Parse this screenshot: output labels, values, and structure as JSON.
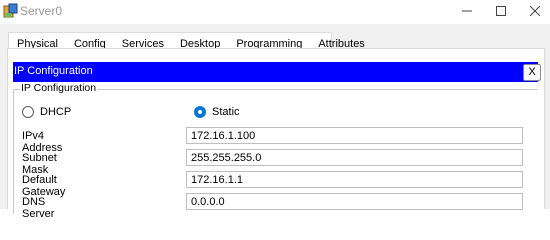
{
  "window": {
    "title": "Server0",
    "icon": "server-app-icon",
    "controls": {
      "minimize": "minimize-icon",
      "maximize": "maximize-icon",
      "close": "close-icon"
    }
  },
  "tabs": [
    {
      "label": "Physical",
      "active": false
    },
    {
      "label": "Config",
      "active": false
    },
    {
      "label": "Services",
      "active": false
    },
    {
      "label": "Desktop",
      "active": true
    },
    {
      "label": "Programming",
      "active": false
    },
    {
      "label": "Attributes",
      "active": false
    }
  ],
  "panel": {
    "header_title": "IP Configuration",
    "close_label": "X",
    "group_title": "IP Configuration",
    "mode": {
      "dhcp_label": "DHCP",
      "static_label": "Static",
      "selected": "Static"
    },
    "fields": [
      {
        "label": "IPv4 Address",
        "value": "172.16.1.100"
      },
      {
        "label": "Subnet Mask",
        "value": "255.255.255.0"
      },
      {
        "label": "Default Gateway",
        "value": "172.16.1.1"
      },
      {
        "label": "DNS Server",
        "value": "0.0.0.0"
      }
    ]
  },
  "colors": {
    "header_bg": "#0000ff",
    "header_text": "#ffffff",
    "tab_underline": "#000080",
    "radio_selected": "#0078d7"
  }
}
